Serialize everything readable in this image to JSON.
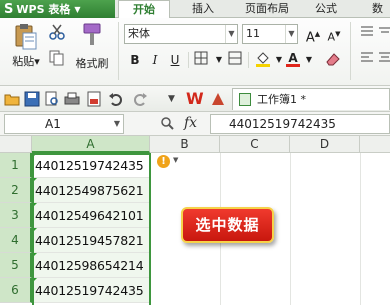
{
  "app": {
    "logo": "S",
    "title": "WPS 表格"
  },
  "tabs": [
    {
      "label": "开始",
      "active": true
    },
    {
      "label": "插入",
      "active": false
    },
    {
      "label": "页面布局",
      "active": false
    },
    {
      "label": "公式",
      "active": false
    },
    {
      "label": "数",
      "active": false
    }
  ],
  "ribbon": {
    "paste_label": "粘贴",
    "format_painter_label": "格式刷",
    "font_name": "宋体",
    "font_size": "11",
    "grow_font": "A",
    "shrink_font": "A",
    "bold": "B",
    "italic": "I",
    "underline": "U",
    "font_color_letter": "A"
  },
  "quick_toolbar": {
    "sheet_tab_label": "工作簿1 *"
  },
  "formula_bar": {
    "name_box": "A1",
    "fx_label": "fx",
    "value": "440125197424​35"
  },
  "grid": {
    "columns": [
      "A",
      "B",
      "C",
      "D"
    ],
    "rows": [
      "1",
      "2",
      "3",
      "4",
      "5",
      "6"
    ],
    "cells_A": [
      "44012519742435",
      "44012549875621",
      "44012549642101",
      "44012519457821",
      "44012598654214",
      "44012519742435"
    ],
    "warning_symbol": "!"
  },
  "callout": {
    "text": "选中数据"
  },
  "colors": {
    "accent_green": "#3e963e",
    "callout_red": "#e0261b",
    "callout_border": "#f6d24a"
  }
}
